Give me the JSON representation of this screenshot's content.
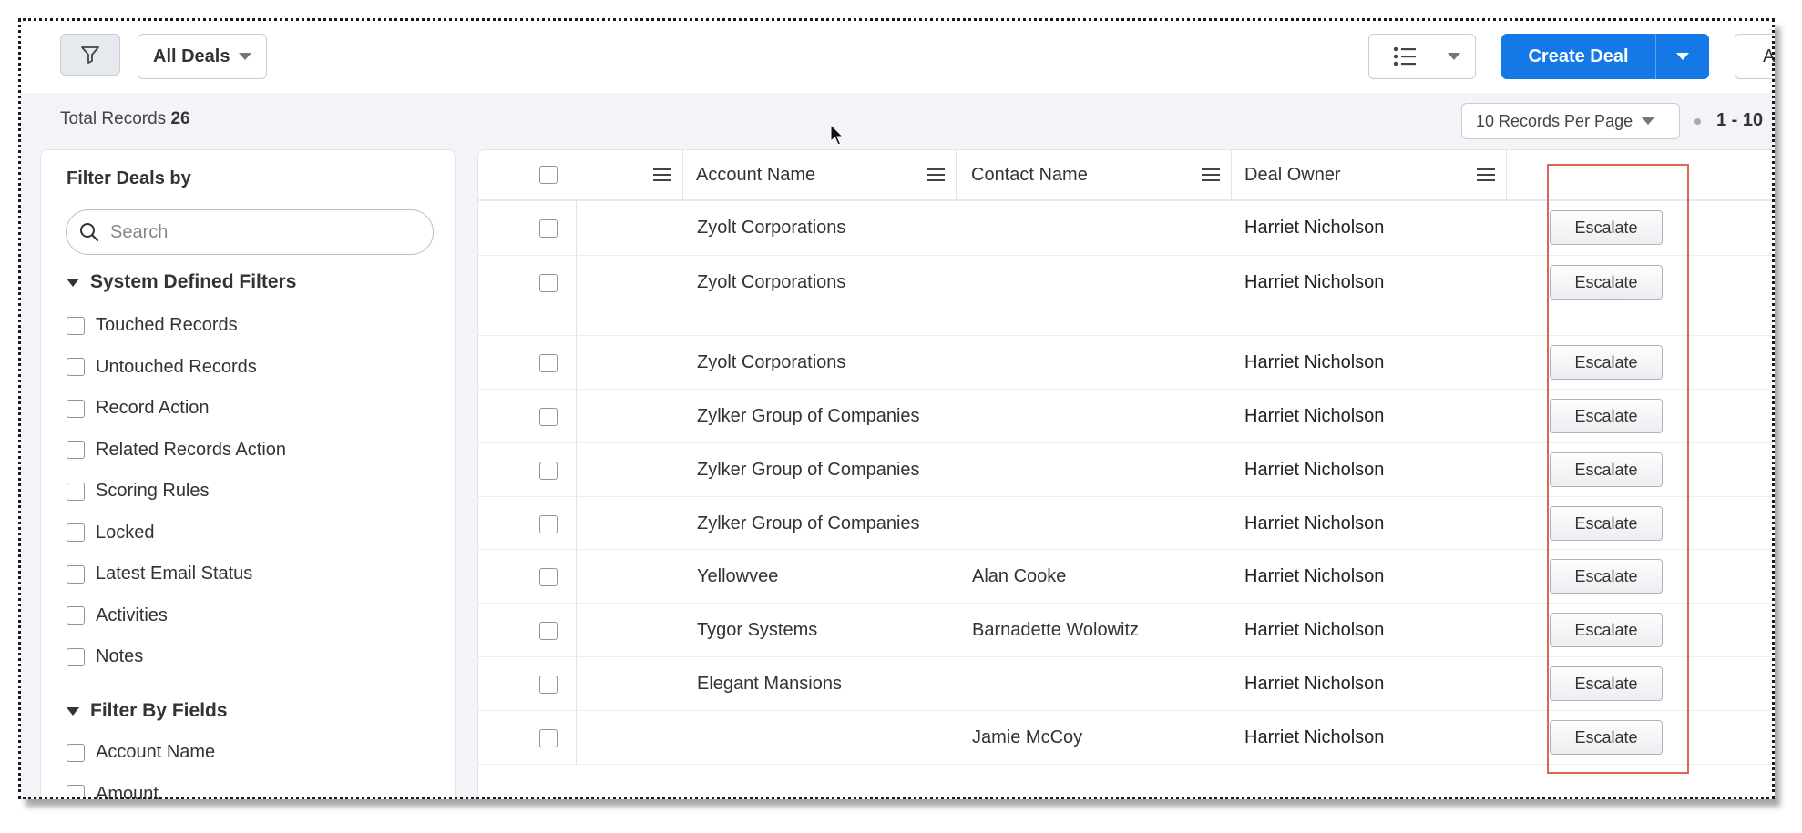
{
  "toolbar": {
    "view_label": "All Deals",
    "create_label": "Create Deal",
    "actions_label_partial": "A"
  },
  "records_bar": {
    "total_label": "Total Records",
    "total_count": "26",
    "per_page_label": "10 Records Per Page",
    "range_label": "1 - 10"
  },
  "sidebar": {
    "title": "Filter Deals by",
    "search_placeholder": "Search",
    "system_section": "System Defined Filters",
    "system_filters": [
      "Touched Records",
      "Untouched Records",
      "Record Action",
      "Related Records Action",
      "Scoring Rules",
      "Locked",
      "Latest Email Status",
      "Activities",
      "Notes"
    ],
    "fields_section": "Filter By Fields",
    "field_filters": [
      "Account Name",
      "Amount"
    ]
  },
  "table": {
    "columns": [
      "Account Name",
      "Contact Name",
      "Deal Owner"
    ],
    "button_label": "Escalate",
    "rows": [
      {
        "account": "Zyolt Corporations",
        "contact": "",
        "owner": "Harriet Nicholson"
      },
      {
        "account": "Zyolt Corporations",
        "contact": "",
        "owner": "Harriet Nicholson"
      },
      {
        "account": "Zyolt Corporations",
        "contact": "",
        "owner": "Harriet Nicholson"
      },
      {
        "account": "Zylker Group of Companies",
        "contact": "",
        "owner": "Harriet Nicholson"
      },
      {
        "account": "Zylker Group of Companies",
        "contact": "",
        "owner": "Harriet Nicholson"
      },
      {
        "account": "Zylker Group of Companies",
        "contact": "",
        "owner": "Harriet Nicholson"
      },
      {
        "account": "Yellowvee",
        "contact": "Alan Cooke",
        "owner": "Harriet Nicholson"
      },
      {
        "account": "Tygor Systems",
        "contact": "Barnadette Wolowitz",
        "owner": "Harriet Nicholson"
      },
      {
        "account": "Elegant Mansions",
        "contact": "",
        "owner": "Harriet Nicholson"
      },
      {
        "account": "",
        "contact": "Jamie McCoy",
        "owner": "Harriet Nicholson"
      }
    ]
  },
  "colors": {
    "primary": "#1478e6",
    "highlight": "#e06452",
    "background": "#f3f4f7"
  }
}
